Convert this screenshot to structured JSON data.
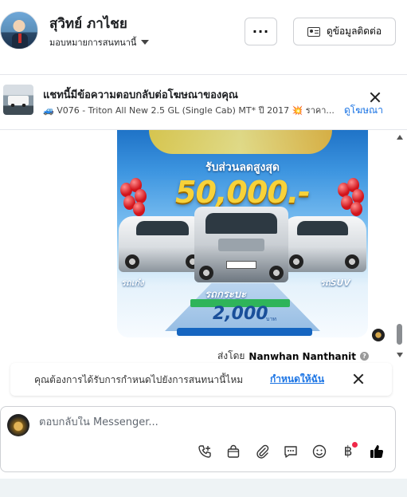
{
  "header": {
    "name": "สุวิทย์ ภาไชย",
    "assign_label": "มอบหมายการสนทนานี้",
    "more_label": "···",
    "contact_label": "ดูข้อมูลติดต่อ"
  },
  "ad_banner": {
    "title": "แชทนี้มีข้อความตอบกลับต่อโฆษณาของคุณ",
    "subtitle": "🚙 V076 - Triton All New 2.5 GL (Single Cab) MT* ปี 2017 💥 ราคา...",
    "link": "ดูโฆษณา"
  },
  "promo_image": {
    "headline": "รับส่วนลดสูงสุด",
    "amount": "50,000.-",
    "label_left": "รถเก๋ง",
    "label_middle": "รถกระบะ",
    "label_right": "รถSUV",
    "price": "2,000",
    "price_unit": "บาท"
  },
  "message": {
    "sent_by_prefix": "ส่งโดย",
    "sent_by_name": "Nanwhan Nanthanit"
  },
  "suggestion": {
    "question": "คุณต้องการได้รับการกำหนดไปยังการสนทนานี้ไหม",
    "action": "กำหนดให้ฉัน"
  },
  "composer": {
    "placeholder": "ตอบกลับใน Messenger..."
  },
  "colors": {
    "accent": "#1b74e4",
    "notification": "#f02849"
  }
}
